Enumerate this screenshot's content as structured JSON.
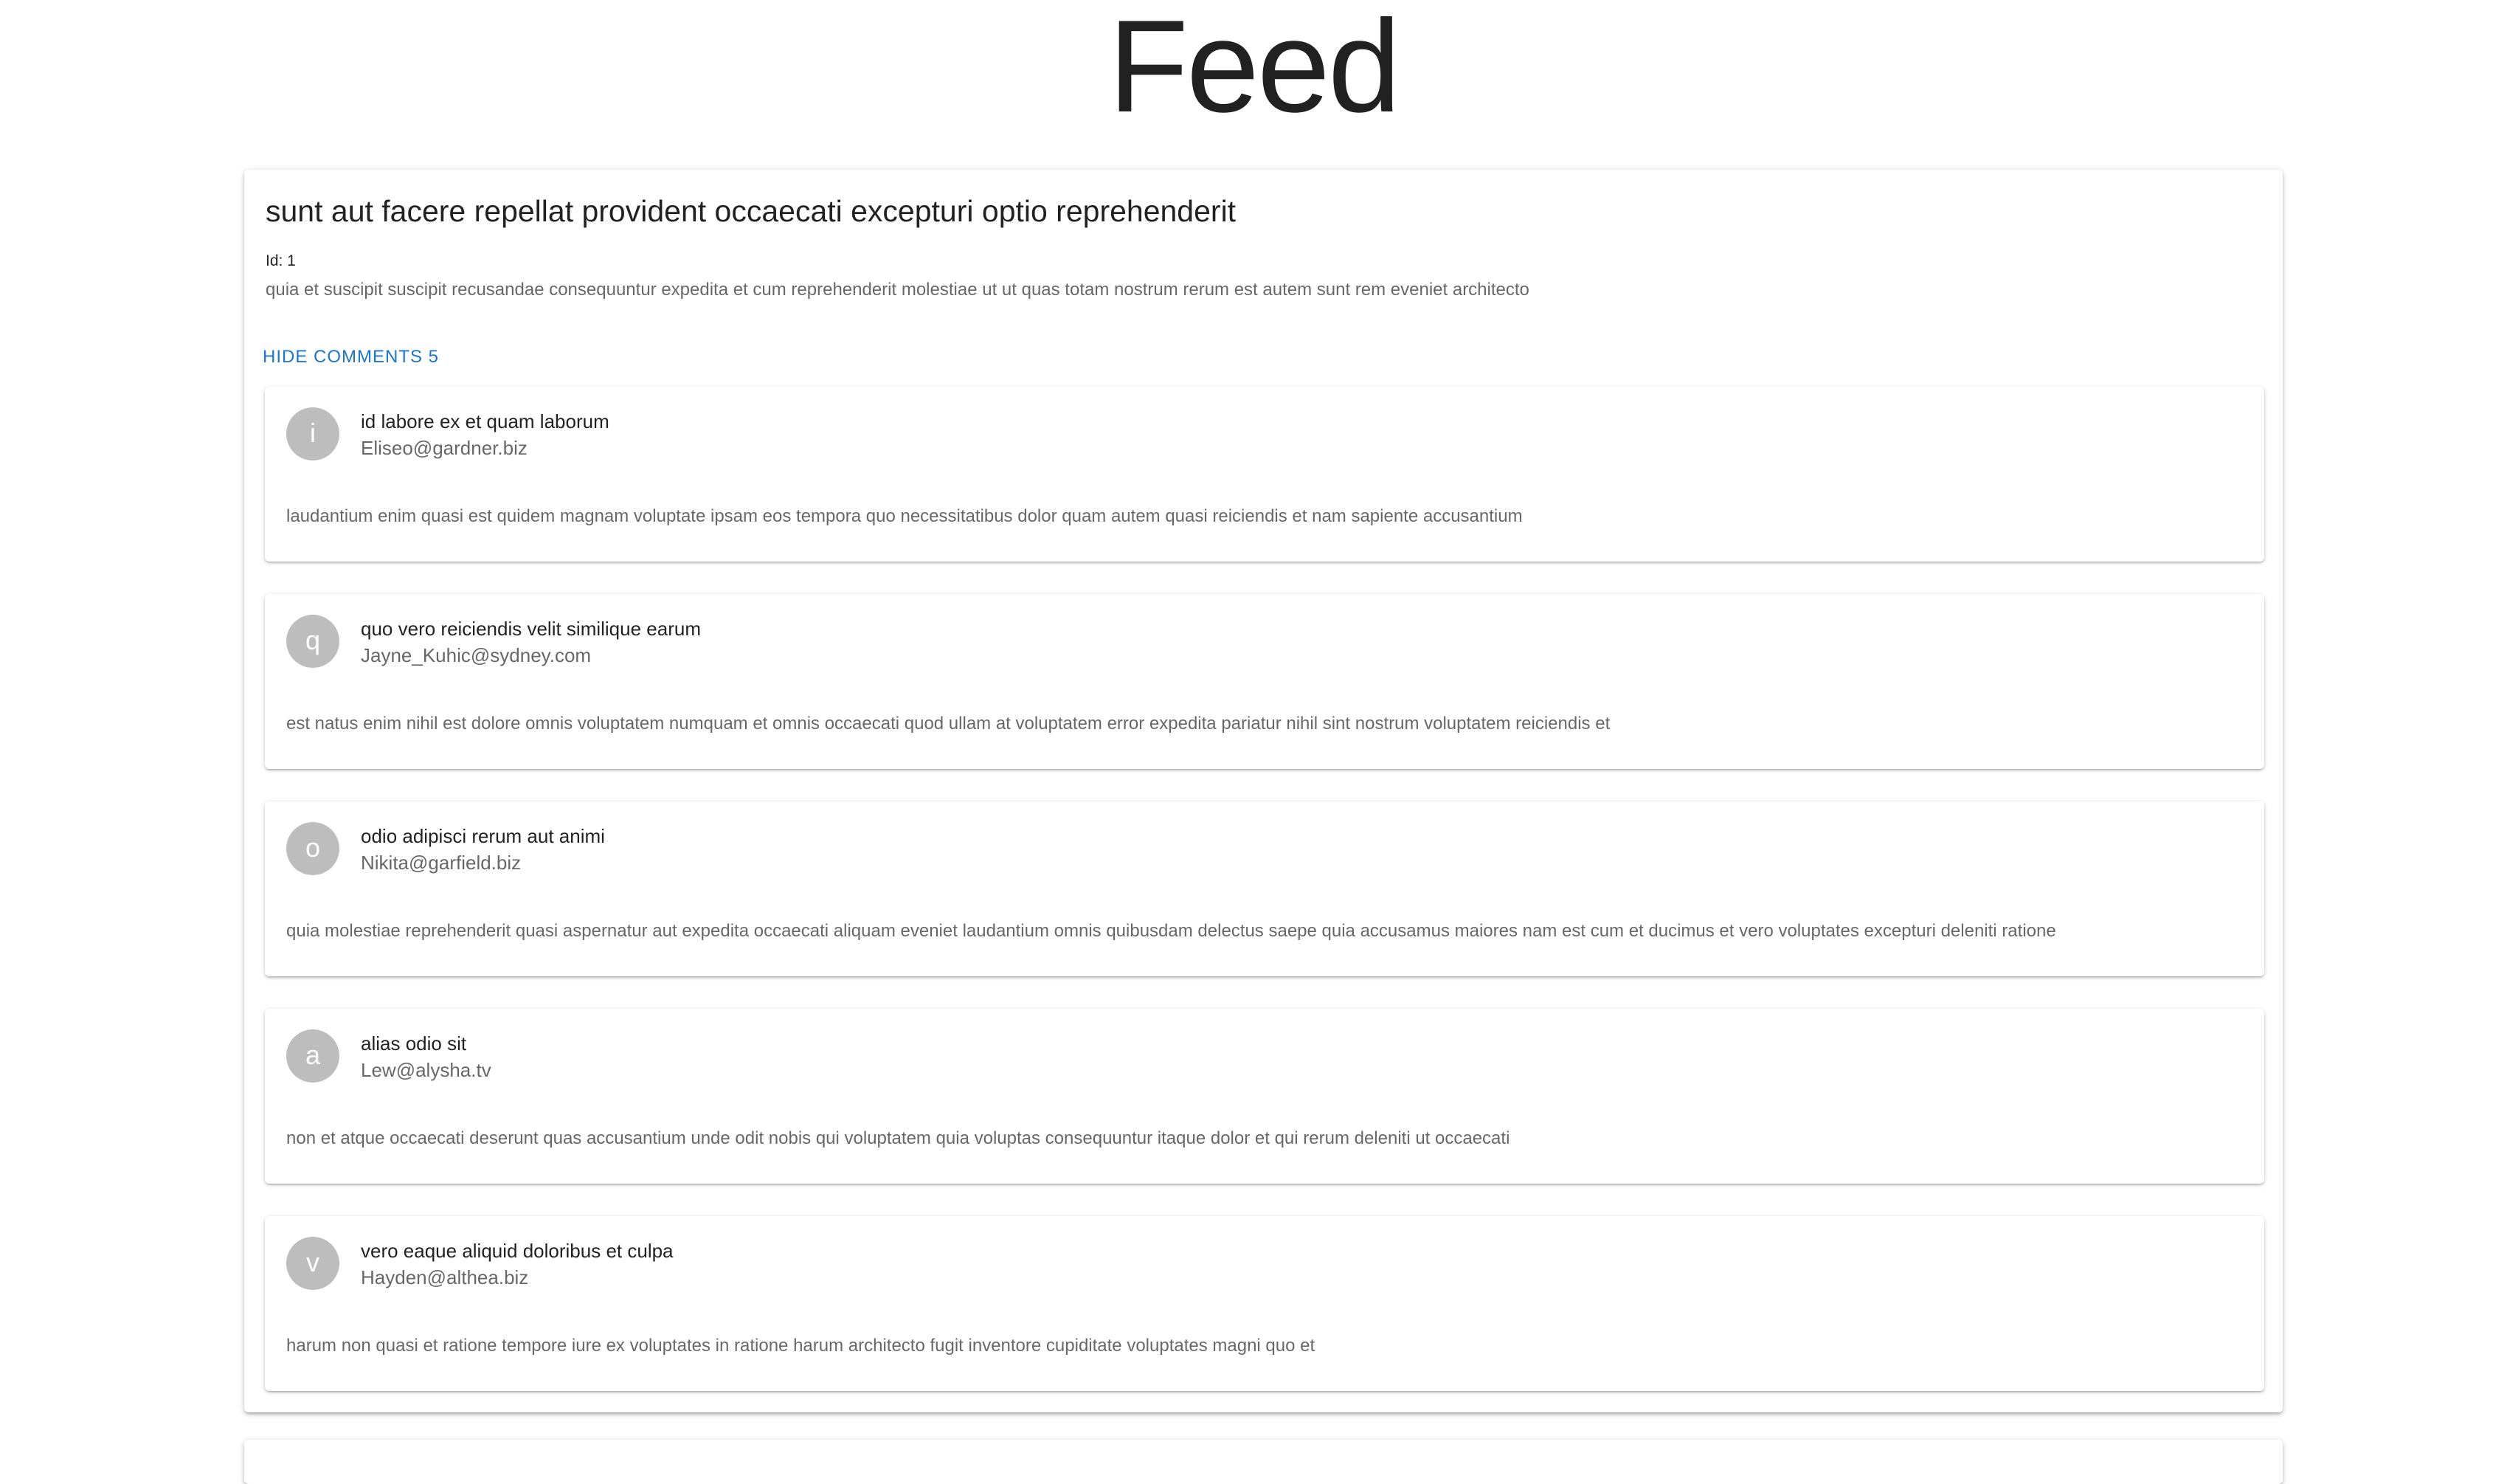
{
  "page": {
    "title": "Feed"
  },
  "post": {
    "title": "sunt aut facere repellat provident occaecati excepturi optio reprehenderit",
    "id_label": "Id: 1",
    "body": "quia et suscipit suscipit recusandae consequuntur expedita et cum reprehenderit molestiae ut ut quas totam nostrum rerum est autem sunt rem eveniet architecto",
    "toggle_label": "HIDE COMMENTS 5",
    "comments": [
      {
        "initial": "i",
        "name": "id labore ex et quam laborum",
        "email": "Eliseo@gardner.biz",
        "body": "laudantium enim quasi est quidem magnam voluptate ipsam eos tempora quo necessitatibus dolor quam autem quasi reiciendis et nam sapiente accusantium"
      },
      {
        "initial": "q",
        "name": "quo vero reiciendis velit similique earum",
        "email": "Jayne_Kuhic@sydney.com",
        "body": "est natus enim nihil est dolore omnis voluptatem numquam et omnis occaecati quod ullam at voluptatem error expedita pariatur nihil sint nostrum voluptatem reiciendis et"
      },
      {
        "initial": "o",
        "name": "odio adipisci rerum aut animi",
        "email": "Nikita@garfield.biz",
        "body": "quia molestiae reprehenderit quasi aspernatur aut expedita occaecati aliquam eveniet laudantium omnis quibusdam delectus saepe quia accusamus maiores nam est cum et ducimus et vero voluptates excepturi deleniti ratione"
      },
      {
        "initial": "a",
        "name": "alias odio sit",
        "email": "Lew@alysha.tv",
        "body": "non et atque occaecati deserunt quas accusantium unde odit nobis qui voluptatem quia voluptas consequuntur itaque dolor et qui rerum deleniti ut occaecati"
      },
      {
        "initial": "v",
        "name": "vero eaque aliquid doloribus et culpa",
        "email": "Hayden@althea.biz",
        "body": "harum non quasi et ratione tempore iure ex voluptates in ratione harum architecto fugit inventore cupiditate voluptates magni quo et"
      }
    ]
  },
  "colors": {
    "accent": "#1976d2",
    "avatar_bg": "#bdbdbd"
  }
}
